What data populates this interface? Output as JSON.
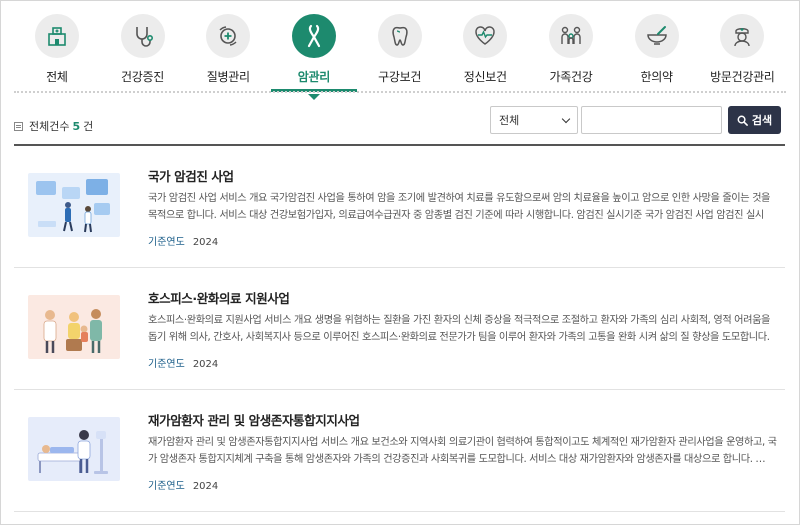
{
  "categories": [
    {
      "label": "전체",
      "icon": "hospital-icon"
    },
    {
      "label": "건강증진",
      "icon": "stethoscope-icon"
    },
    {
      "label": "질병관리",
      "icon": "disease-control-icon"
    },
    {
      "label": "암관리",
      "icon": "cancer-ribbon-icon",
      "active": true
    },
    {
      "label": "구강보건",
      "icon": "tooth-icon"
    },
    {
      "label": "정신보건",
      "icon": "heart-pulse-icon"
    },
    {
      "label": "가족건강",
      "icon": "family-icon"
    },
    {
      "label": "한의약",
      "icon": "mortar-pestle-icon"
    },
    {
      "label": "방문건강관리",
      "icon": "nurse-icon"
    }
  ],
  "toolbar": {
    "total_label": "전체건수",
    "total_count": "5",
    "total_unit": "건",
    "select_value": "전체",
    "search_value": "",
    "search_label": "검색"
  },
  "items": [
    {
      "title": "국가 암검진 사업",
      "desc": "국가 암검진 사업 서비스 개요 국가암검진 사업을 통하여 암을 조기에 발견하여 치료를 유도함으로써 암의 치료율을 높이고 암으로 인한 사망을 줄이는 것을 목적으로 합니다. 서비스 대상 건강보험가입자, 의료급여수급권자 중 암종별 검진 기준에 따라 시행합니다. 암검진 실시기준 국가 암검진 사업 암검진 실시기…",
      "year_label": "기준연도",
      "year": "2024",
      "thumb": "screening-illustration"
    },
    {
      "title": "호스피스·완화의료 지원사업",
      "desc": "호스피스·완화의료 지원사업 서비스 개요 생명을 위협하는 질환을 가진 환자의 신체 증상을 적극적으로 조절하고 환자와 가족의 심리 사회적, 영적 어려움을 돕기 위해 의사, 간호사, 사회복지사 등으로 이루어진 호스피스·완화의료 전문가가 팀을 이루어 환자와 가족의 고통을 완화 시켜 삶의 질 향상을 도모합니다. …",
      "year_label": "기준연도",
      "year": "2024",
      "thumb": "hospice-team-illustration"
    },
    {
      "title": "재가암환자 관리 및 암생존자통합지지사업",
      "desc": "재가암환자 관리 및 암생존자통합지지사업 서비스 개요 보건소와 지역사회 의료기관이 협력하여 통합적이고도 체계적인 재가암환자 관리사업을 운영하고, 국가 암생존자 통합지지체계 구축을 통해 암생존자와 가족의 건강증진과 사회복귀를 도모합니다. 서비스 대상 재가암환자와 암생존자를 대상으로 합니다. …",
      "year_label": "기준연도",
      "year": "2024",
      "thumb": "home-care-illustration"
    }
  ],
  "colors": {
    "accent": "#1d8a6e",
    "button_dark": "#2d3448",
    "icon_inactive_bg": "#ececec"
  }
}
